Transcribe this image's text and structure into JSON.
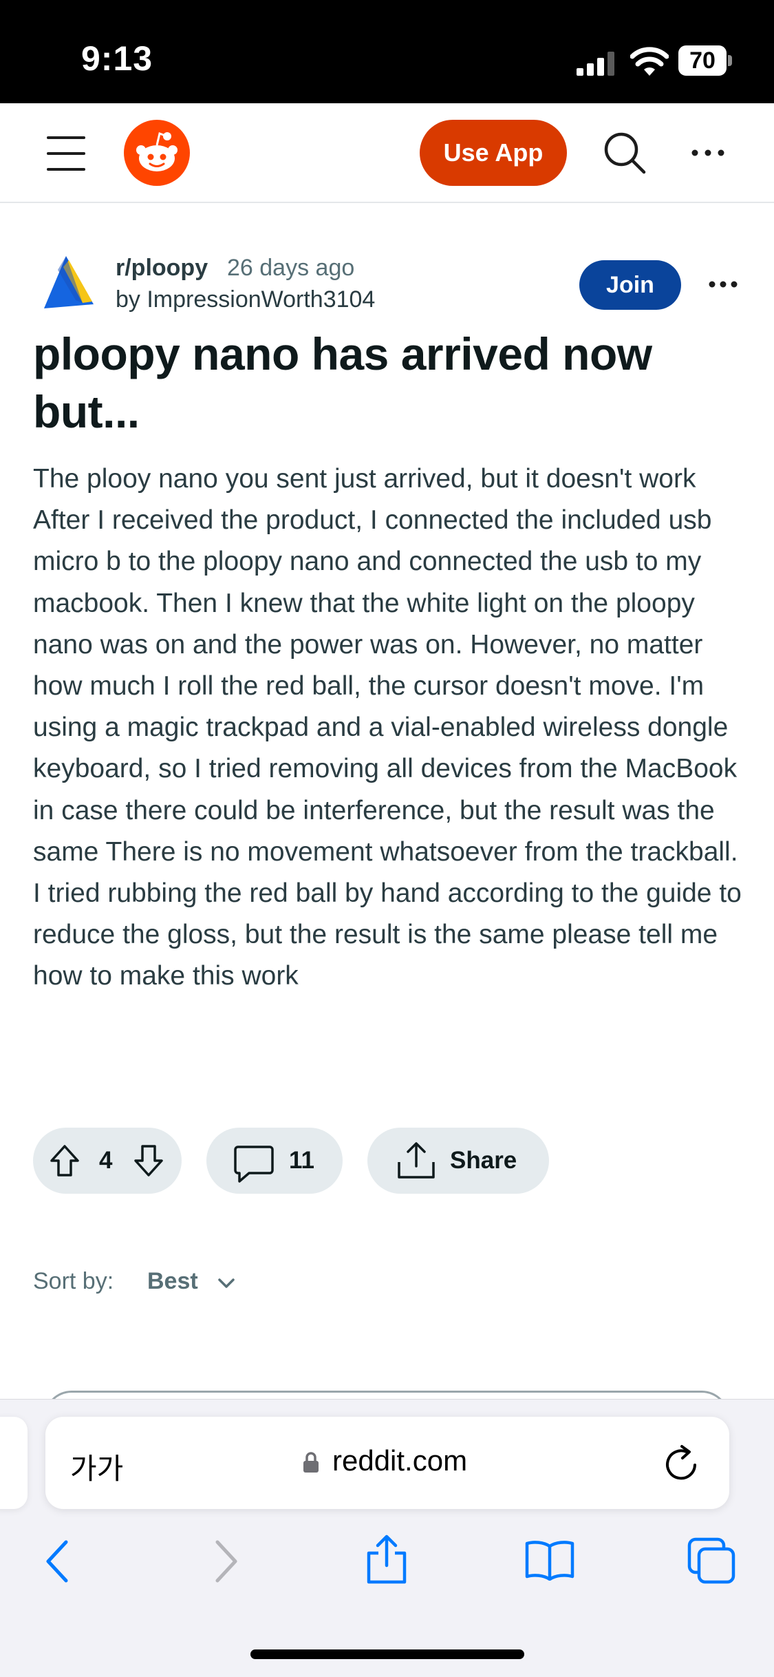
{
  "status_bar": {
    "time": "9:13",
    "battery": "70"
  },
  "header": {
    "use_app_label": "Use App"
  },
  "post": {
    "subreddit": "r/ploopy",
    "age": "26 days ago",
    "author": "by ImpressionWorth3104",
    "join_label": "Join",
    "title": "ploopy nano has arrived now but...",
    "body": "The plooy nano you sent just arrived, but it doesn't work After I received the product, I connected the included usb micro b to the ploopy nano and connected the usb to my macbook. Then I knew that the white light on the ploopy nano was on and the power was on. However, no matter how much I roll the red ball, the cursor doesn't move. I'm using a magic trackpad and a vial-enabled wireless dongle keyboard, so I tried removing all devices from the MacBook in case there could be interference, but the result was the same There is no movement whatsoever from the trackball. I tried rubbing the red ball by hand according to the guide to reduce the gloss, but the result is the same please tell me how to make this work",
    "votes": "4",
    "comments": "11",
    "share_label": "Share"
  },
  "sort": {
    "label": "Sort by:",
    "value": "Best"
  },
  "browser": {
    "text_size_label": "가가",
    "domain": "reddit.com"
  },
  "colors": {
    "brand": "#ff4500",
    "use_app": "#d93a00",
    "join": "#0a449b",
    "ios_blue": "#007aff"
  },
  "icons": [
    "signal-icon",
    "wifi-icon",
    "battery-icon",
    "menu-icon",
    "reddit-logo-icon",
    "search-icon",
    "more-icon",
    "subreddit-icon",
    "upvote-icon",
    "downvote-icon",
    "comment-icon",
    "share-icon",
    "chevron-down-icon",
    "lock-icon",
    "reload-icon",
    "back-icon",
    "forward-icon",
    "share-sheet-icon",
    "bookmarks-icon",
    "tabs-icon"
  ]
}
